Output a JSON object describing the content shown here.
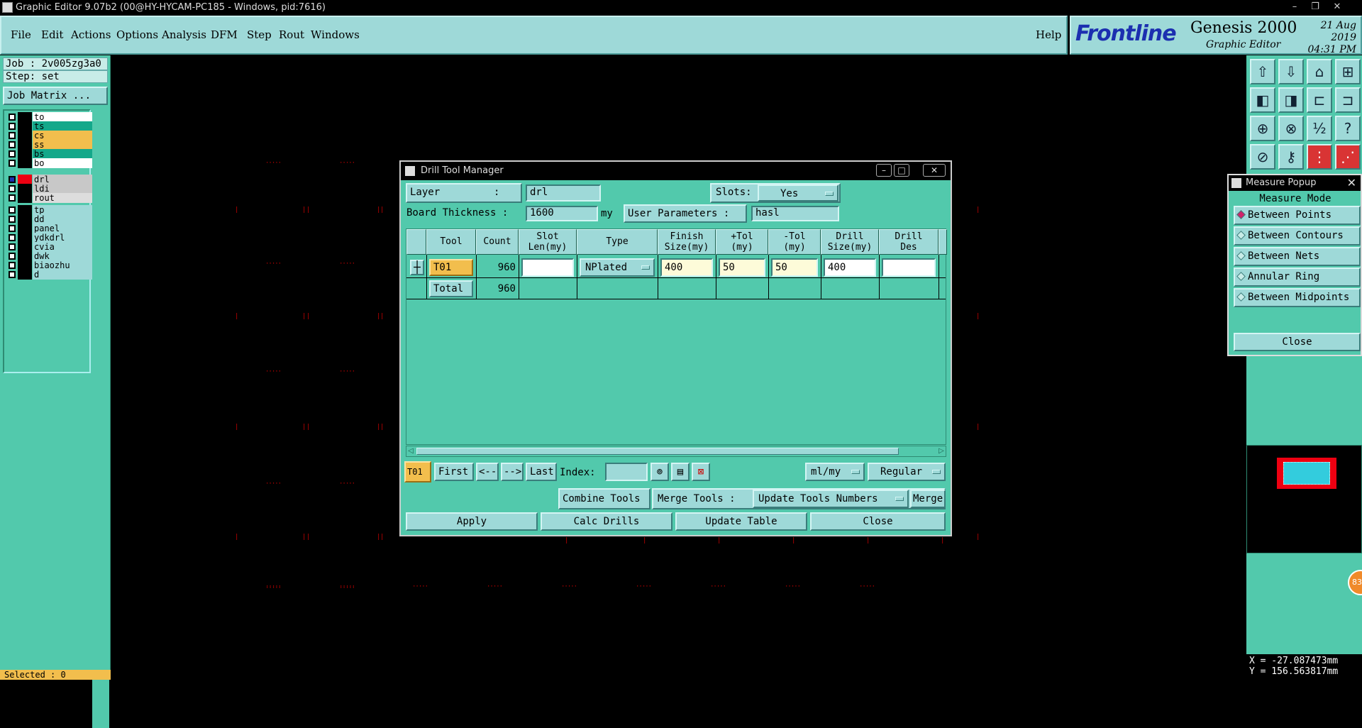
{
  "window": {
    "title": "Graphic Editor 9.07b2 (00@HY-HYCAM-PC185 - Windows, pid:7616)",
    "controls": [
      "–",
      "❐",
      "✕"
    ]
  },
  "menu": {
    "items": [
      "File",
      "Edit",
      "Actions",
      "Options",
      "Analysis",
      "DFM",
      "Step",
      "Rout",
      "Windows"
    ],
    "help": "Help"
  },
  "brand": {
    "logo": "Frontline",
    "product": "Genesis 2000",
    "subtitle": "Graphic Editor",
    "date": "21 Aug 2019",
    "time": "04:31 PM"
  },
  "left_panel": {
    "job": "Job : 2v005zg3a0",
    "step": "Step: set",
    "job_matrix_button": "Job Matrix ...",
    "layers": [
      {
        "name": "to",
        "color": "#ffffff"
      },
      {
        "name": "ts",
        "color": "#14a88a"
      },
      {
        "name": "cs",
        "color": "#f2be4d"
      },
      {
        "name": "ss",
        "color": "#f2be4d"
      },
      {
        "name": "bs",
        "color": "#14a88a"
      },
      {
        "name": "bo",
        "color": "#ffffff"
      },
      {
        "name": "drl",
        "color": "#c8c8c8",
        "active": true
      },
      {
        "name": "ldi",
        "color": "#c8c8c8"
      },
      {
        "name": "rout",
        "color": "#dddddd"
      },
      {
        "name": "tp",
        "color": "#9ed9d8"
      },
      {
        "name": "dd",
        "color": "#9ed9d8"
      },
      {
        "name": "panel",
        "color": "#9ed9d8"
      },
      {
        "name": "ydkdrl",
        "color": "#9ed9d8"
      },
      {
        "name": "cvia",
        "color": "#9ed9d8"
      },
      {
        "name": "dwk",
        "color": "#9ed9d8"
      },
      {
        "name": "biaozhu",
        "color": "#9ed9d8"
      },
      {
        "name": "d",
        "color": "#9ed9d8"
      }
    ],
    "selected": "Selected : 0"
  },
  "drill_tool_manager": {
    "title": "Drill Tool Manager",
    "layer_label": "Layer         :",
    "layer_value": "drl",
    "slots_label": "Slots:",
    "slots_value": "Yes",
    "board_thickness_label": "Board Thickness :",
    "board_thickness_value": "1600",
    "board_thickness_unit": "my",
    "user_parameters_label": "User Parameters :",
    "user_parameters_value": "hasl",
    "columns": [
      "Tool",
      "Count",
      "Slot\nLen(my)",
      "Type",
      "Finish\nSize(my)",
      "+Tol\n(my)",
      "-Tol\n(my)",
      "Drill\nSize(my)",
      "Drill\nDes"
    ],
    "rows": [
      {
        "tool": "T01",
        "count": "960",
        "slot_len": "",
        "type": "NPlated",
        "finish_size": "400",
        "plus_tol": "50",
        "minus_tol": "50",
        "drill_size": "400",
        "drill_des": ""
      }
    ],
    "total_label": "Total",
    "total_count": "960",
    "nav": {
      "current": "T01",
      "first": "First",
      "prev": "<--",
      "next": "-->",
      "last": "Last",
      "index_label": "Index:",
      "index_value": "",
      "units": "ml/my",
      "mode": "Regular"
    },
    "combine_tools": "Combine Tools",
    "merge_tools_label": "Merge Tools :",
    "merge_tools_value": "Update Tools Numbers",
    "merge": "Merge",
    "apply": "Apply",
    "calc_drills": "Calc Drills",
    "update_table": "Update Table",
    "close": "Close"
  },
  "measure_popup": {
    "title": "Measure Popup",
    "mode_label": "Measure Mode",
    "options": [
      "Between Points",
      "Between Contours",
      "Between Nets",
      "Annular Ring",
      "Between Midpoints"
    ],
    "selected_index": 0,
    "close": "Close"
  },
  "toolbar_icons": [
    "layer-up-icon",
    "layer-down-icon",
    "home-icon",
    "split-icon",
    "move-left-icon",
    "move-right-icon",
    "snap-icon",
    "route-icon",
    "fit-icon",
    "center-icon",
    "scale-icon",
    "help-icon",
    "measure-icon",
    "key-icon",
    "drill-icon",
    "graph-icon"
  ],
  "coordinates": {
    "x": "X = -27.087473mm",
    "y": "Y = 156.563817mm"
  },
  "badge": "83"
}
